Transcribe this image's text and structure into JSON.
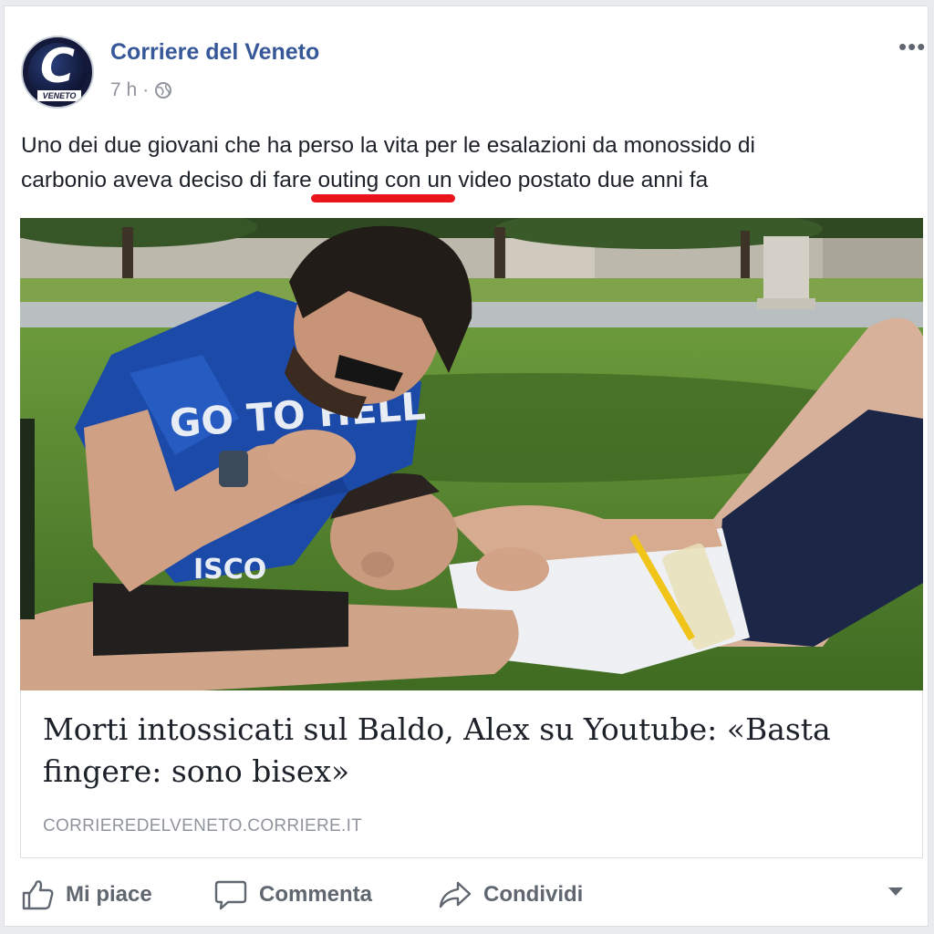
{
  "post": {
    "page_name": "Corriere del Veneto",
    "avatar_letter": "C",
    "avatar_sub": "VENETO",
    "time": "7 h",
    "separator": "·",
    "text_line1": "Uno dei due giovani che ha perso la vita per le esalazioni da monossido di",
    "text_line2": "carbonio aveva deciso di fare outing con un video postato due anni fa",
    "more_label": "•••"
  },
  "link": {
    "title": "Morti intossicati sul Baldo, Alex su Youtube: «Basta fingere: sono bisex»",
    "domain": "CORRIEREDELVENETO.CORRIERE.IT"
  },
  "photo": {
    "shirt_text": "GO TO HELL",
    "shirt_text2": "ISCO"
  },
  "actions": {
    "like": "Mi piace",
    "comment": "Commenta",
    "share": "Condividi"
  },
  "colors": {
    "link_blue": "#365899",
    "highlight_red": "#e8131b",
    "muted": "#90949c"
  },
  "icons": [
    "globe-icon",
    "more-options-icon",
    "like-icon",
    "comment-icon",
    "share-icon",
    "caret-down-icon"
  ]
}
